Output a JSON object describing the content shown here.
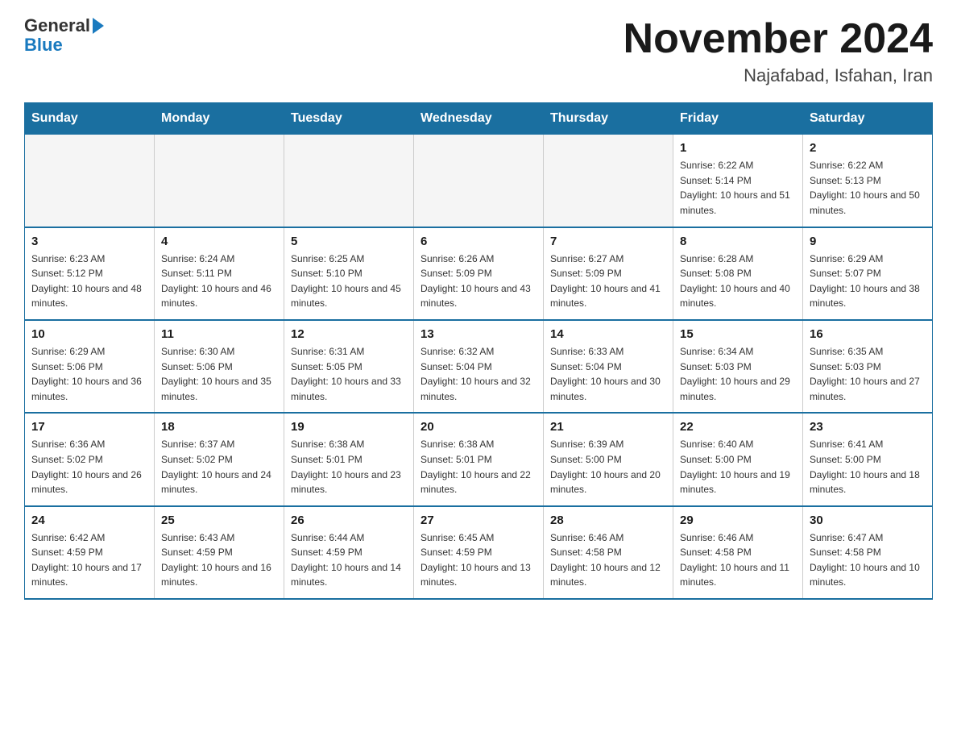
{
  "header": {
    "logo_text_general": "General",
    "logo_text_blue": "Blue",
    "month_year": "November 2024",
    "location": "Najafabad, Isfahan, Iran"
  },
  "days_of_week": [
    "Sunday",
    "Monday",
    "Tuesday",
    "Wednesday",
    "Thursday",
    "Friday",
    "Saturday"
  ],
  "weeks": [
    [
      {
        "day": "",
        "info": ""
      },
      {
        "day": "",
        "info": ""
      },
      {
        "day": "",
        "info": ""
      },
      {
        "day": "",
        "info": ""
      },
      {
        "day": "",
        "info": ""
      },
      {
        "day": "1",
        "info": "Sunrise: 6:22 AM\nSunset: 5:14 PM\nDaylight: 10 hours and 51 minutes."
      },
      {
        "day": "2",
        "info": "Sunrise: 6:22 AM\nSunset: 5:13 PM\nDaylight: 10 hours and 50 minutes."
      }
    ],
    [
      {
        "day": "3",
        "info": "Sunrise: 6:23 AM\nSunset: 5:12 PM\nDaylight: 10 hours and 48 minutes."
      },
      {
        "day": "4",
        "info": "Sunrise: 6:24 AM\nSunset: 5:11 PM\nDaylight: 10 hours and 46 minutes."
      },
      {
        "day": "5",
        "info": "Sunrise: 6:25 AM\nSunset: 5:10 PM\nDaylight: 10 hours and 45 minutes."
      },
      {
        "day": "6",
        "info": "Sunrise: 6:26 AM\nSunset: 5:09 PM\nDaylight: 10 hours and 43 minutes."
      },
      {
        "day": "7",
        "info": "Sunrise: 6:27 AM\nSunset: 5:09 PM\nDaylight: 10 hours and 41 minutes."
      },
      {
        "day": "8",
        "info": "Sunrise: 6:28 AM\nSunset: 5:08 PM\nDaylight: 10 hours and 40 minutes."
      },
      {
        "day": "9",
        "info": "Sunrise: 6:29 AM\nSunset: 5:07 PM\nDaylight: 10 hours and 38 minutes."
      }
    ],
    [
      {
        "day": "10",
        "info": "Sunrise: 6:29 AM\nSunset: 5:06 PM\nDaylight: 10 hours and 36 minutes."
      },
      {
        "day": "11",
        "info": "Sunrise: 6:30 AM\nSunset: 5:06 PM\nDaylight: 10 hours and 35 minutes."
      },
      {
        "day": "12",
        "info": "Sunrise: 6:31 AM\nSunset: 5:05 PM\nDaylight: 10 hours and 33 minutes."
      },
      {
        "day": "13",
        "info": "Sunrise: 6:32 AM\nSunset: 5:04 PM\nDaylight: 10 hours and 32 minutes."
      },
      {
        "day": "14",
        "info": "Sunrise: 6:33 AM\nSunset: 5:04 PM\nDaylight: 10 hours and 30 minutes."
      },
      {
        "day": "15",
        "info": "Sunrise: 6:34 AM\nSunset: 5:03 PM\nDaylight: 10 hours and 29 minutes."
      },
      {
        "day": "16",
        "info": "Sunrise: 6:35 AM\nSunset: 5:03 PM\nDaylight: 10 hours and 27 minutes."
      }
    ],
    [
      {
        "day": "17",
        "info": "Sunrise: 6:36 AM\nSunset: 5:02 PM\nDaylight: 10 hours and 26 minutes."
      },
      {
        "day": "18",
        "info": "Sunrise: 6:37 AM\nSunset: 5:02 PM\nDaylight: 10 hours and 24 minutes."
      },
      {
        "day": "19",
        "info": "Sunrise: 6:38 AM\nSunset: 5:01 PM\nDaylight: 10 hours and 23 minutes."
      },
      {
        "day": "20",
        "info": "Sunrise: 6:38 AM\nSunset: 5:01 PM\nDaylight: 10 hours and 22 minutes."
      },
      {
        "day": "21",
        "info": "Sunrise: 6:39 AM\nSunset: 5:00 PM\nDaylight: 10 hours and 20 minutes."
      },
      {
        "day": "22",
        "info": "Sunrise: 6:40 AM\nSunset: 5:00 PM\nDaylight: 10 hours and 19 minutes."
      },
      {
        "day": "23",
        "info": "Sunrise: 6:41 AM\nSunset: 5:00 PM\nDaylight: 10 hours and 18 minutes."
      }
    ],
    [
      {
        "day": "24",
        "info": "Sunrise: 6:42 AM\nSunset: 4:59 PM\nDaylight: 10 hours and 17 minutes."
      },
      {
        "day": "25",
        "info": "Sunrise: 6:43 AM\nSunset: 4:59 PM\nDaylight: 10 hours and 16 minutes."
      },
      {
        "day": "26",
        "info": "Sunrise: 6:44 AM\nSunset: 4:59 PM\nDaylight: 10 hours and 14 minutes."
      },
      {
        "day": "27",
        "info": "Sunrise: 6:45 AM\nSunset: 4:59 PM\nDaylight: 10 hours and 13 minutes."
      },
      {
        "day": "28",
        "info": "Sunrise: 6:46 AM\nSunset: 4:58 PM\nDaylight: 10 hours and 12 minutes."
      },
      {
        "day": "29",
        "info": "Sunrise: 6:46 AM\nSunset: 4:58 PM\nDaylight: 10 hours and 11 minutes."
      },
      {
        "day": "30",
        "info": "Sunrise: 6:47 AM\nSunset: 4:58 PM\nDaylight: 10 hours and 10 minutes."
      }
    ]
  ]
}
